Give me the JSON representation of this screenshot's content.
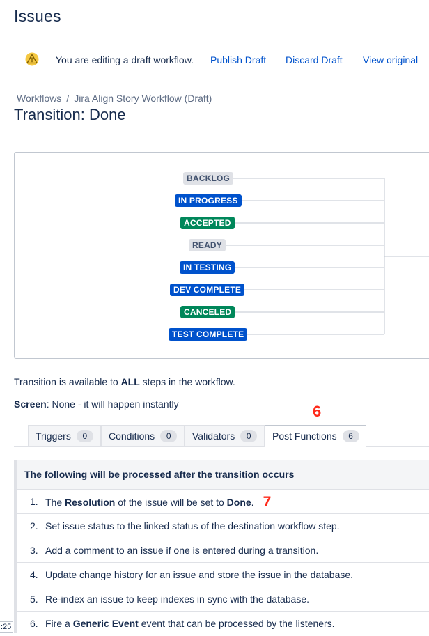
{
  "page": {
    "title": "Issues"
  },
  "draft_banner": {
    "message": "You are editing a draft workflow.",
    "publish": "Publish Draft",
    "discard": "Discard Draft",
    "view_original": "View original"
  },
  "breadcrumbs": {
    "workflows": "Workflows",
    "separator": "/",
    "workflow_name": "Jira Align Story Workflow (Draft)"
  },
  "transition_title": "Transition: Done",
  "diagram": {
    "statuses": [
      {
        "name": "BACKLOG",
        "category": "gray"
      },
      {
        "name": "IN PROGRESS",
        "category": "blue"
      },
      {
        "name": "ACCEPTED",
        "category": "green"
      },
      {
        "name": "READY",
        "category": "gray"
      },
      {
        "name": "IN TESTING",
        "category": "blue"
      },
      {
        "name": "DEV COMPLETE",
        "category": "blue"
      },
      {
        "name": "CANCELED",
        "category": "green"
      },
      {
        "name": "TEST COMPLETE",
        "category": "blue"
      }
    ]
  },
  "availability": {
    "prefix": "Transition is available to ",
    "emphasis": "ALL",
    "suffix": " steps in the workflow."
  },
  "screen": {
    "label": "Screen",
    "value": ": None - it will happen instantly"
  },
  "annotations": {
    "tab_marker": "6",
    "row_marker": "7"
  },
  "tabs": [
    {
      "label": "Triggers",
      "count": "0"
    },
    {
      "label": "Conditions",
      "count": "0"
    },
    {
      "label": "Validators",
      "count": "0"
    },
    {
      "label": "Post Functions",
      "count": "6"
    }
  ],
  "post_functions": {
    "header": "The following will be processed after the transition occurs",
    "items": [
      {
        "num": "1.",
        "pre": "The ",
        "b1": "Resolution",
        "mid": " of the issue will be set to ",
        "b2": "Done",
        "post": "."
      },
      {
        "num": "2.",
        "text": "Set issue status to the linked status of the destination workflow step."
      },
      {
        "num": "3.",
        "text": "Add a comment to an issue if one is entered during a transition."
      },
      {
        "num": "4.",
        "text": "Update change history for an issue and store the issue in the database."
      },
      {
        "num": "5.",
        "text": "Re-index an issue to keep indexes in sync with the database."
      },
      {
        "num": "6.",
        "pre": "Fire a ",
        "b1": "Generic Event",
        "post": " event that can be processed by the listeners."
      }
    ]
  },
  "colors": {
    "link": "#0052cc",
    "status_blue": "#0052cc",
    "status_green": "#00875a",
    "status_gray": "#dfe1e6",
    "annotation_red": "#ff2a1a"
  },
  "icons": {
    "draft_banner": "warning-icon"
  },
  "clock_fragment": ":25"
}
